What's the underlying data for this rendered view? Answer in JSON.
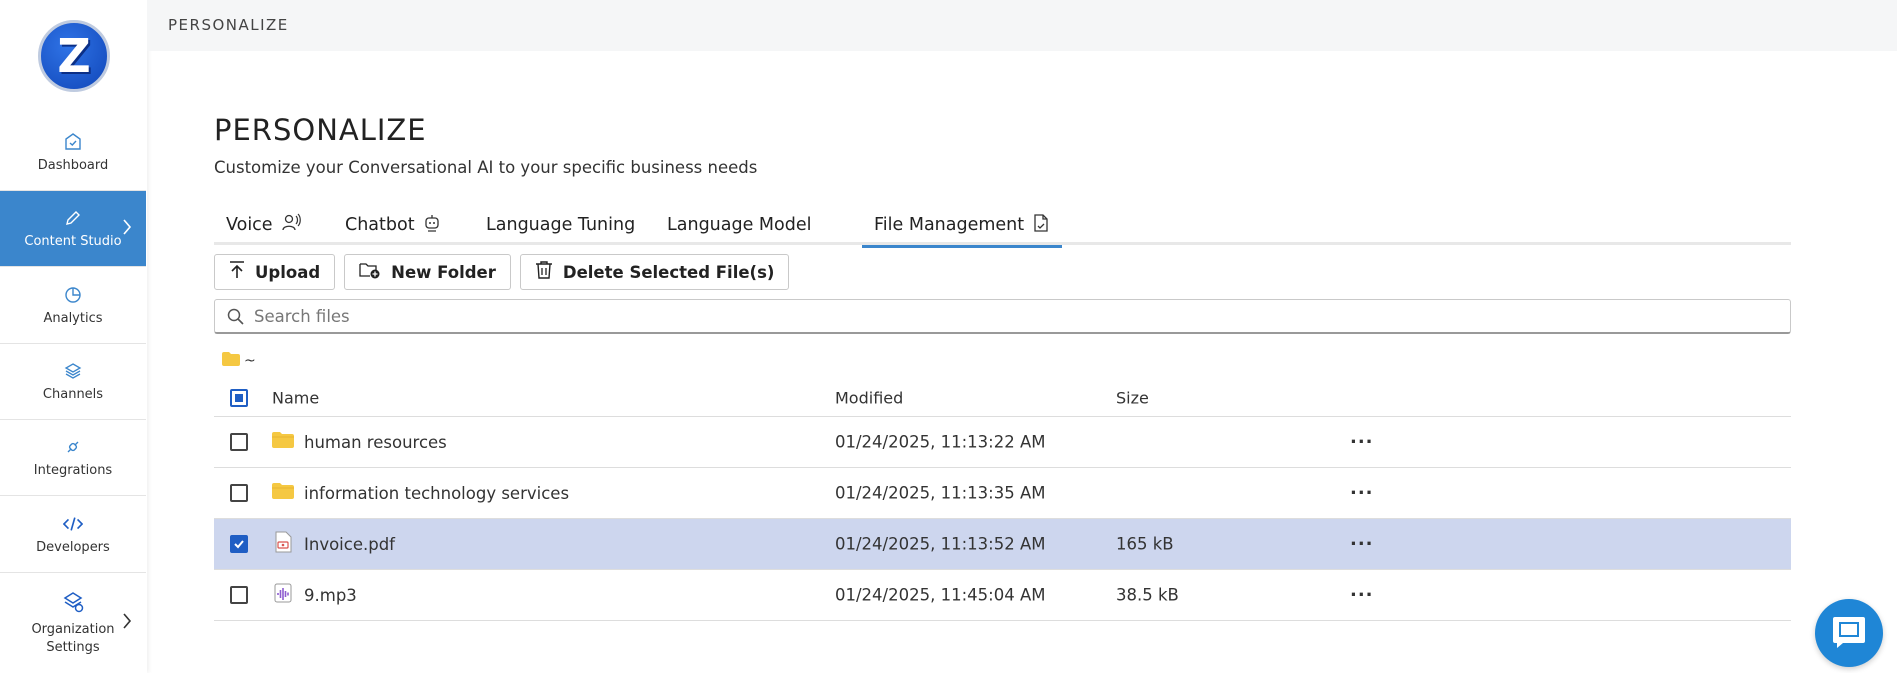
{
  "topbar": {
    "title": "PERSONALIZE"
  },
  "logo": {
    "letter": "Z"
  },
  "sidebar": {
    "items": [
      {
        "label": "Dashboard",
        "icon": "dashboard-icon"
      },
      {
        "label": "Content Studio",
        "icon": "pencil-icon",
        "active": true
      },
      {
        "label": "Analytics",
        "icon": "pie-chart-icon"
      },
      {
        "label": "Channels",
        "icon": "layers-icon"
      },
      {
        "label": "Integrations",
        "icon": "plug-icon"
      },
      {
        "label": "Developers",
        "icon": "code-icon"
      },
      {
        "label": "Organization Settings",
        "icon": "org-settings-icon"
      }
    ]
  },
  "page": {
    "title": "PERSONALIZE",
    "subtitle": "Customize your Conversational AI to your specific business needs"
  },
  "tabs": [
    {
      "label": "Voice",
      "icon": "voice-icon"
    },
    {
      "label": "Chatbot",
      "icon": "robot-icon"
    },
    {
      "label": "Language Tuning"
    },
    {
      "label": "Language Model"
    },
    {
      "label": "File Management",
      "icon": "file-manage-icon",
      "active": true
    }
  ],
  "toolbar": {
    "upload_label": "Upload",
    "new_folder_label": "New Folder",
    "delete_label": "Delete Selected File(s)"
  },
  "search": {
    "placeholder": "Search files"
  },
  "breadcrumb": {
    "path": "~"
  },
  "table": {
    "headers": {
      "name": "Name",
      "modified": "Modified",
      "size": "Size"
    },
    "rows": [
      {
        "name": "human resources",
        "type": "folder",
        "modified": "01/24/2025, 11:13:22 AM",
        "size": "",
        "checked": false
      },
      {
        "name": "information technology services",
        "type": "folder",
        "modified": "01/24/2025, 11:13:35 AM",
        "size": "",
        "checked": false
      },
      {
        "name": "Invoice.pdf",
        "type": "pdf",
        "modified": "01/24/2025, 11:13:52 AM",
        "size": "165 kB",
        "checked": true
      },
      {
        "name": "9.mp3",
        "type": "audio",
        "modified": "01/24/2025, 11:45:04 AM",
        "size": "38.5 kB",
        "checked": false
      }
    ],
    "actions_label": "···"
  },
  "colors": {
    "accent": "#3b86cc",
    "selected_row": "#cdd6ee",
    "folder": "#f5c842"
  }
}
